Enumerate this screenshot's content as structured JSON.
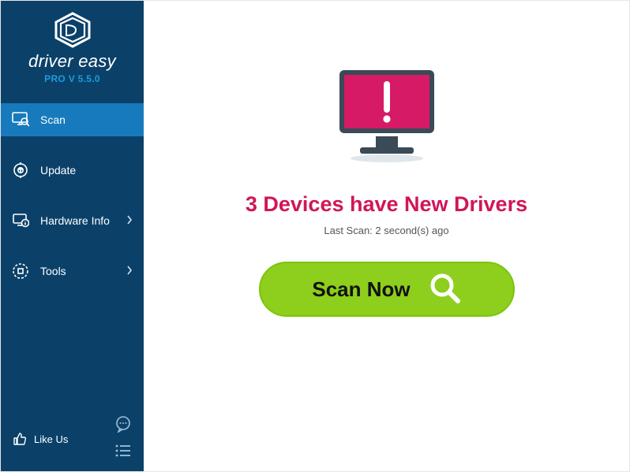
{
  "brand": {
    "name": "driver easy",
    "version": "PRO V 5.5.0"
  },
  "sidebar": {
    "items": [
      {
        "label": "Scan",
        "has_submenu": false,
        "active": true
      },
      {
        "label": "Update",
        "has_submenu": false,
        "active": false
      },
      {
        "label": "Hardware Info",
        "has_submenu": true,
        "active": false
      },
      {
        "label": "Tools",
        "has_submenu": true,
        "active": false
      }
    ],
    "like_us": "Like Us"
  },
  "main": {
    "headline": "3 Devices have New Drivers",
    "last_scan": "Last Scan: 2 second(s) ago",
    "scan_button": "Scan Now"
  },
  "colors": {
    "sidebar_bg": "#0b4169",
    "sidebar_active": "#177abd",
    "accent_magenta": "#d11559",
    "scan_green": "#8dcf1c"
  }
}
